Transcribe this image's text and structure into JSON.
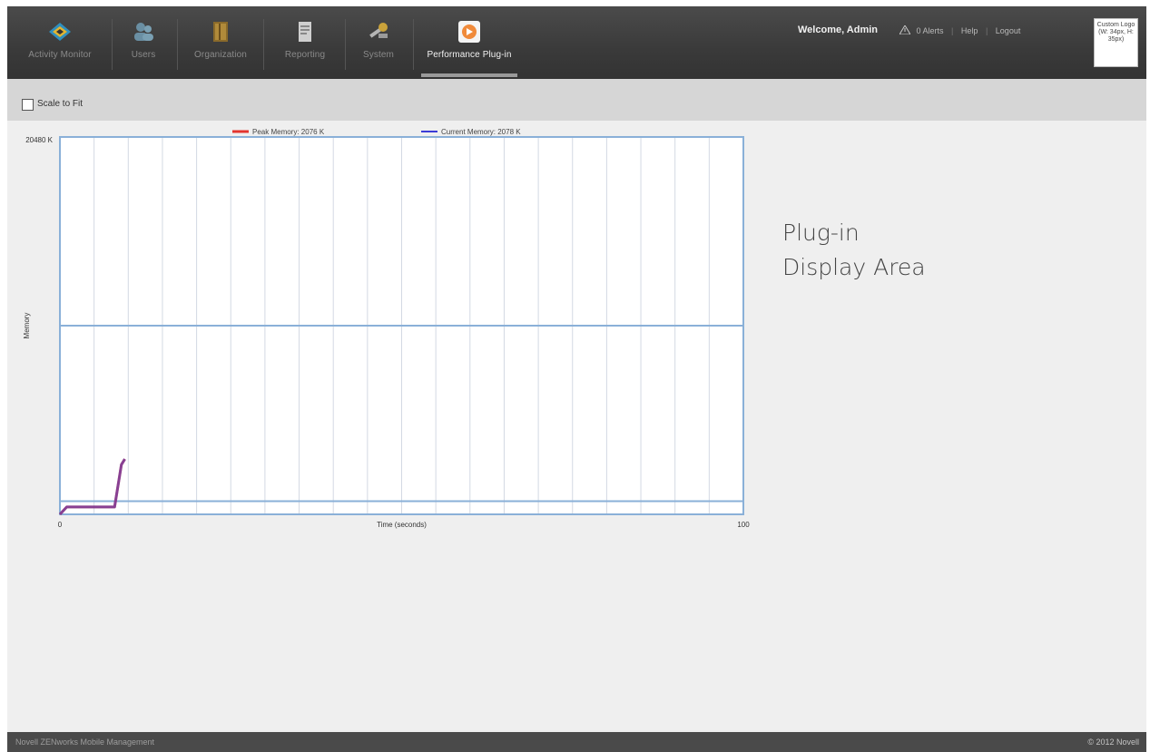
{
  "nav": {
    "items": [
      {
        "label": "Activity Monitor",
        "icon": "activity-monitor-icon"
      },
      {
        "label": "Users",
        "icon": "users-icon"
      },
      {
        "label": "Organization",
        "icon": "organization-icon"
      },
      {
        "label": "Reporting",
        "icon": "reporting-icon"
      },
      {
        "label": "System",
        "icon": "system-icon"
      },
      {
        "label": "Performance Plug-in",
        "icon": "performance-plugin-icon"
      }
    ]
  },
  "header": {
    "welcome": "Welcome, Admin",
    "alerts": "0 Alerts",
    "help": "Help",
    "logout": "Logout",
    "logo": "Custom Logo (W: 34px, H: 35px)"
  },
  "toolbar": {
    "scale_label": "Scale to Fit",
    "scale_checked": false
  },
  "plugin_area": {
    "line1": "Plug-in",
    "line2": "Display Area"
  },
  "footer": {
    "left": "Novell ZENworks Mobile Management",
    "right": "© 2012 Novell"
  },
  "chart_data": {
    "type": "line",
    "title": "",
    "xlabel": "Time (seconds)",
    "ylabel": "Memory",
    "xlim": [
      0,
      100
    ],
    "ylim": [
      0,
      20480
    ],
    "x_ticks": [
      "0",
      "100"
    ],
    "y_ticks": [
      "20480 K"
    ],
    "grid": true,
    "legend_position": "top",
    "series": [
      {
        "name": "Peak Memory: 2076 K",
        "color": "#e3342f",
        "x": [
          0,
          1,
          8,
          9,
          9.5
        ],
        "y": [
          0,
          400,
          400,
          2700,
          3000
        ]
      },
      {
        "name": "Current Memory: 2078 K",
        "color": "#3b3bd6",
        "x": [
          0,
          1,
          8,
          9,
          9.5
        ],
        "y": [
          0,
          400,
          400,
          2700,
          3000
        ]
      }
    ]
  }
}
